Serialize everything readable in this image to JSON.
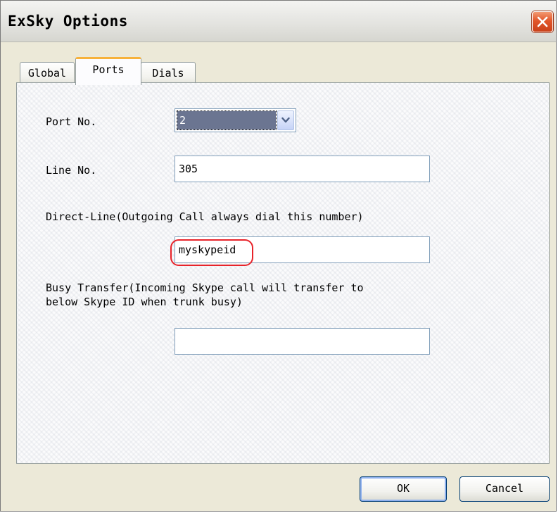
{
  "window": {
    "title": "ExSky Options"
  },
  "tabs": [
    {
      "label": "Global",
      "selected": false
    },
    {
      "label": "Ports",
      "selected": true
    },
    {
      "label": "Dials",
      "selected": false
    }
  ],
  "form": {
    "port_no_label": "Port No.",
    "port_no_value": "2",
    "line_no_label": "Line No.",
    "line_no_value": "305",
    "direct_line_label": "Direct-Line(Outgoing Call always dial this number)",
    "direct_line_value": "myskypeid",
    "busy_transfer_label_line1": "Busy Transfer(Incoming Skype call will transfer to",
    "busy_transfer_label_line2": "below Skype ID when trunk busy)",
    "busy_transfer_value": ""
  },
  "buttons": {
    "ok_label": "OK",
    "cancel_label": "Cancel"
  },
  "icons": {
    "close": "close-icon",
    "dropdown": "chevron-down-icon"
  },
  "colors": {
    "close_button": "#e2562a",
    "selected_tab_accent": "#f7b23b",
    "annotation_oval": "#e8232a",
    "selection_highlight": "#6b7591"
  }
}
